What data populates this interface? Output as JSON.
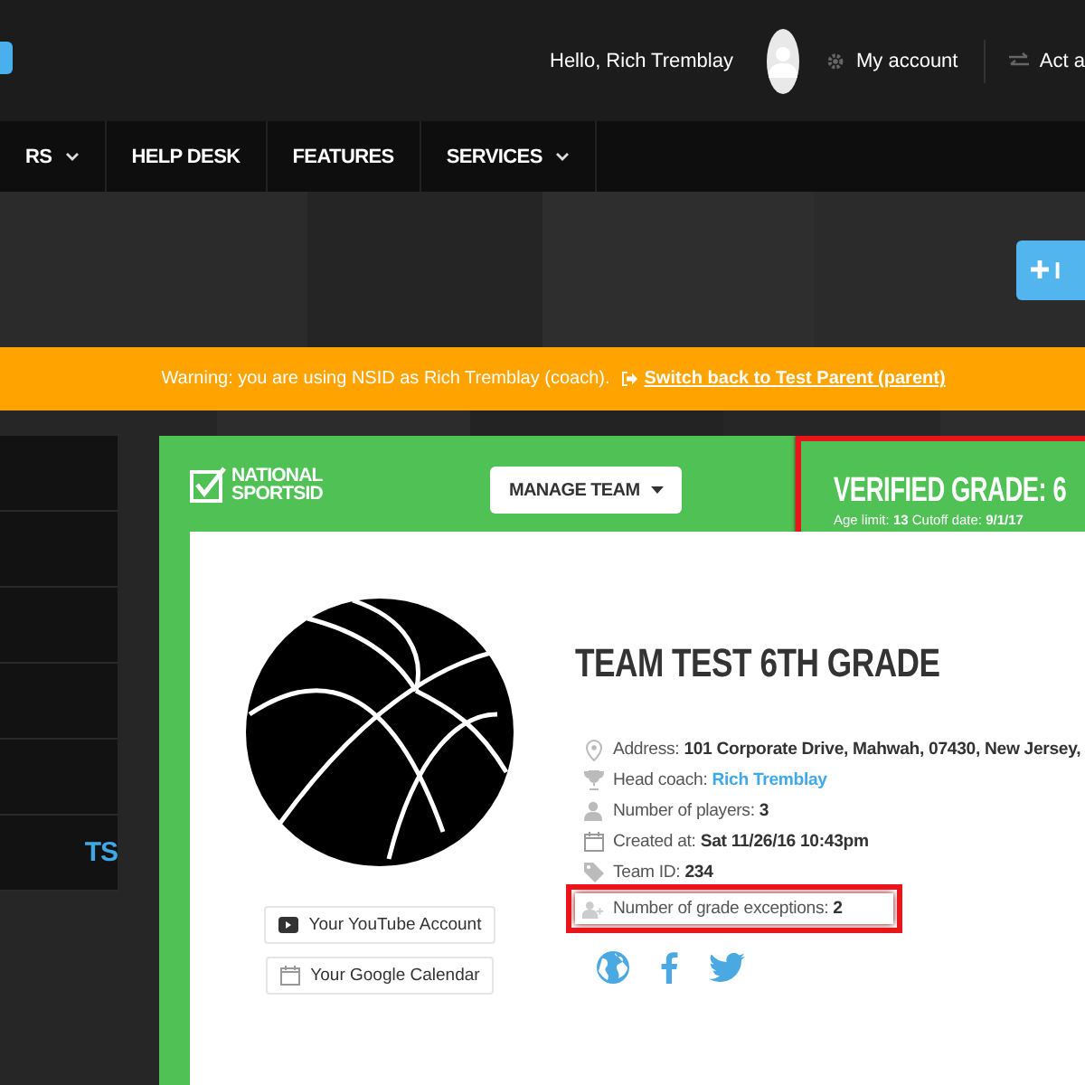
{
  "header": {
    "greeting": "Hello, Rich Tremblay",
    "account_link": "My account",
    "act_as_link": "Act a"
  },
  "nav": [
    {
      "label": "RS",
      "dropdown": true
    },
    {
      "label": "HELP DESK",
      "dropdown": false
    },
    {
      "label": "FEATURES",
      "dropdown": false
    },
    {
      "label": "SERVICES",
      "dropdown": true
    }
  ],
  "hero": {
    "button_label": "I"
  },
  "warning": {
    "text": "Warning: you are using NSID as Rich Tremblay (coach).",
    "link": "Switch back to Test Parent (parent)"
  },
  "sidebar": {
    "items": [
      {
        "label": "TS",
        "selected": true
      }
    ]
  },
  "team_card": {
    "brand": [
      "NATIONAL",
      "SPORTSID"
    ],
    "manage_button": "MANAGE TEAM",
    "verified": {
      "title": "VERIFIED GRADE: 6",
      "details": "Age limit: **13** Cutoff date: **9/1/17**",
      "highlighted": true
    },
    "team_name": "TEAM TEST 6TH GRADE",
    "details": [
      {
        "text": "Address: **101 Corporate Drive, Mahwah, 07430, New Jersey,**",
        "highlighted": false
      },
      {
        "text": "Head coach:",
        "link": "Rich Tremblay",
        "highlighted": false
      },
      {
        "text": "Number of players: **3**",
        "highlighted": false
      },
      {
        "text": "Created at: **Sat 11/26/16 10:43pm**",
        "highlighted": false
      },
      {
        "text": "Team ID: **234**",
        "highlighted": false
      },
      {
        "text": "Number of grade exceptions: **2**",
        "highlighted": true
      }
    ],
    "buttons": [
      {
        "label": "Your YouTube Account"
      },
      {
        "label": "Your Google Calendar"
      }
    ]
  }
}
